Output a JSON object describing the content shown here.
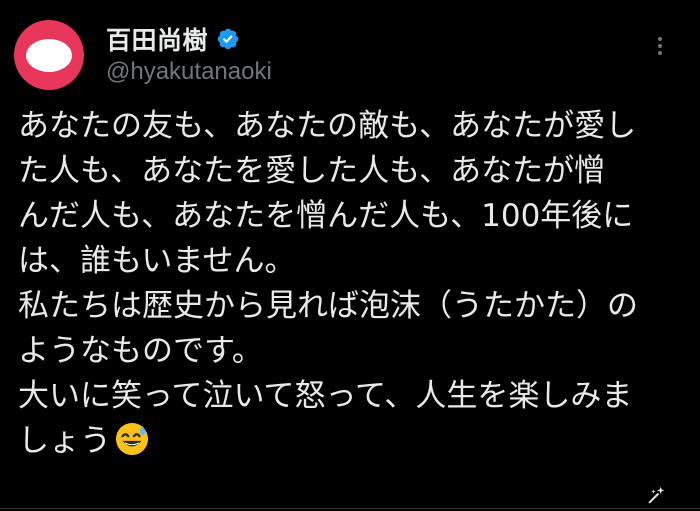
{
  "author": {
    "display_name": "百田尚樹",
    "handle": "@hyakutanaoki",
    "verified": true
  },
  "tweet": {
    "lines": [
      "あなたの友も、あなたの敵も、あなたが愛し",
      "た人も、あなたを愛した人も、あなたが憎",
      "んだ人も、あなたを憎んだ人も、100年後に",
      "は、誰もいません。",
      "私たちは歴史から見れば泡沫（うたかた）の",
      "ようなものです。",
      "大いに笑って泣いて怒って、人生を楽しみま",
      "しょう"
    ],
    "trailing_emoji": "smiling-face-with-sweat-icon"
  },
  "icons": {
    "more": "more-options-icon",
    "verified": "verified-badge-icon",
    "grok": "grok-icon"
  },
  "colors": {
    "background": "#000000",
    "text": "#e7e9ea",
    "secondary_text": "#71767b",
    "verified_blue": "#1d9bf0",
    "avatar_red": "#e8365a"
  }
}
